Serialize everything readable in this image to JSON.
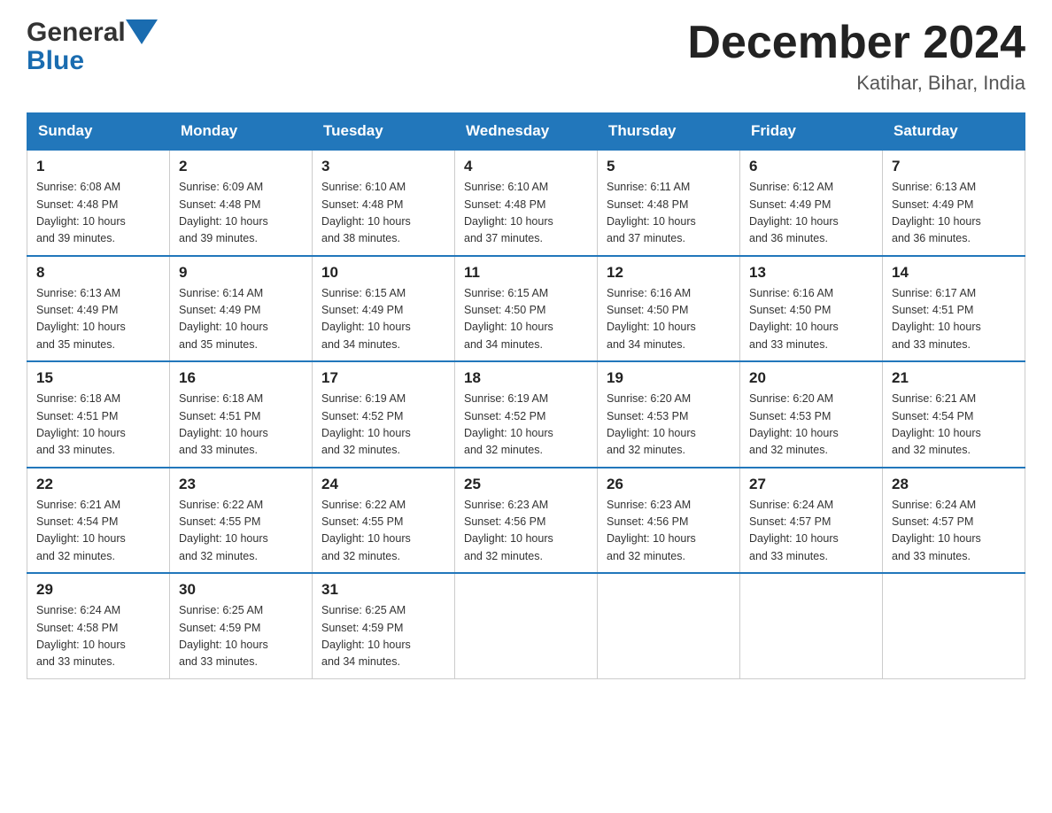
{
  "header": {
    "logo_line1": "General",
    "logo_line2": "Blue",
    "month_title": "December 2024",
    "location": "Katihar, Bihar, India"
  },
  "days_of_week": [
    "Sunday",
    "Monday",
    "Tuesday",
    "Wednesday",
    "Thursday",
    "Friday",
    "Saturday"
  ],
  "weeks": [
    [
      {
        "day": "1",
        "sunrise": "6:08 AM",
        "sunset": "4:48 PM",
        "daylight": "10 hours and 39 minutes."
      },
      {
        "day": "2",
        "sunrise": "6:09 AM",
        "sunset": "4:48 PM",
        "daylight": "10 hours and 39 minutes."
      },
      {
        "day": "3",
        "sunrise": "6:10 AM",
        "sunset": "4:48 PM",
        "daylight": "10 hours and 38 minutes."
      },
      {
        "day": "4",
        "sunrise": "6:10 AM",
        "sunset": "4:48 PM",
        "daylight": "10 hours and 37 minutes."
      },
      {
        "day": "5",
        "sunrise": "6:11 AM",
        "sunset": "4:48 PM",
        "daylight": "10 hours and 37 minutes."
      },
      {
        "day": "6",
        "sunrise": "6:12 AM",
        "sunset": "4:49 PM",
        "daylight": "10 hours and 36 minutes."
      },
      {
        "day": "7",
        "sunrise": "6:13 AM",
        "sunset": "4:49 PM",
        "daylight": "10 hours and 36 minutes."
      }
    ],
    [
      {
        "day": "8",
        "sunrise": "6:13 AM",
        "sunset": "4:49 PM",
        "daylight": "10 hours and 35 minutes."
      },
      {
        "day": "9",
        "sunrise": "6:14 AM",
        "sunset": "4:49 PM",
        "daylight": "10 hours and 35 minutes."
      },
      {
        "day": "10",
        "sunrise": "6:15 AM",
        "sunset": "4:49 PM",
        "daylight": "10 hours and 34 minutes."
      },
      {
        "day": "11",
        "sunrise": "6:15 AM",
        "sunset": "4:50 PM",
        "daylight": "10 hours and 34 minutes."
      },
      {
        "day": "12",
        "sunrise": "6:16 AM",
        "sunset": "4:50 PM",
        "daylight": "10 hours and 34 minutes."
      },
      {
        "day": "13",
        "sunrise": "6:16 AM",
        "sunset": "4:50 PM",
        "daylight": "10 hours and 33 minutes."
      },
      {
        "day": "14",
        "sunrise": "6:17 AM",
        "sunset": "4:51 PM",
        "daylight": "10 hours and 33 minutes."
      }
    ],
    [
      {
        "day": "15",
        "sunrise": "6:18 AM",
        "sunset": "4:51 PM",
        "daylight": "10 hours and 33 minutes."
      },
      {
        "day": "16",
        "sunrise": "6:18 AM",
        "sunset": "4:51 PM",
        "daylight": "10 hours and 33 minutes."
      },
      {
        "day": "17",
        "sunrise": "6:19 AM",
        "sunset": "4:52 PM",
        "daylight": "10 hours and 32 minutes."
      },
      {
        "day": "18",
        "sunrise": "6:19 AM",
        "sunset": "4:52 PM",
        "daylight": "10 hours and 32 minutes."
      },
      {
        "day": "19",
        "sunrise": "6:20 AM",
        "sunset": "4:53 PM",
        "daylight": "10 hours and 32 minutes."
      },
      {
        "day": "20",
        "sunrise": "6:20 AM",
        "sunset": "4:53 PM",
        "daylight": "10 hours and 32 minutes."
      },
      {
        "day": "21",
        "sunrise": "6:21 AM",
        "sunset": "4:54 PM",
        "daylight": "10 hours and 32 minutes."
      }
    ],
    [
      {
        "day": "22",
        "sunrise": "6:21 AM",
        "sunset": "4:54 PM",
        "daylight": "10 hours and 32 minutes."
      },
      {
        "day": "23",
        "sunrise": "6:22 AM",
        "sunset": "4:55 PM",
        "daylight": "10 hours and 32 minutes."
      },
      {
        "day": "24",
        "sunrise": "6:22 AM",
        "sunset": "4:55 PM",
        "daylight": "10 hours and 32 minutes."
      },
      {
        "day": "25",
        "sunrise": "6:23 AM",
        "sunset": "4:56 PM",
        "daylight": "10 hours and 32 minutes."
      },
      {
        "day": "26",
        "sunrise": "6:23 AM",
        "sunset": "4:56 PM",
        "daylight": "10 hours and 32 minutes."
      },
      {
        "day": "27",
        "sunrise": "6:24 AM",
        "sunset": "4:57 PM",
        "daylight": "10 hours and 33 minutes."
      },
      {
        "day": "28",
        "sunrise": "6:24 AM",
        "sunset": "4:57 PM",
        "daylight": "10 hours and 33 minutes."
      }
    ],
    [
      {
        "day": "29",
        "sunrise": "6:24 AM",
        "sunset": "4:58 PM",
        "daylight": "10 hours and 33 minutes."
      },
      {
        "day": "30",
        "sunrise": "6:25 AM",
        "sunset": "4:59 PM",
        "daylight": "10 hours and 33 minutes."
      },
      {
        "day": "31",
        "sunrise": "6:25 AM",
        "sunset": "4:59 PM",
        "daylight": "10 hours and 34 minutes."
      },
      null,
      null,
      null,
      null
    ]
  ],
  "labels": {
    "sunrise": "Sunrise:",
    "sunset": "Sunset:",
    "daylight": "Daylight:"
  }
}
